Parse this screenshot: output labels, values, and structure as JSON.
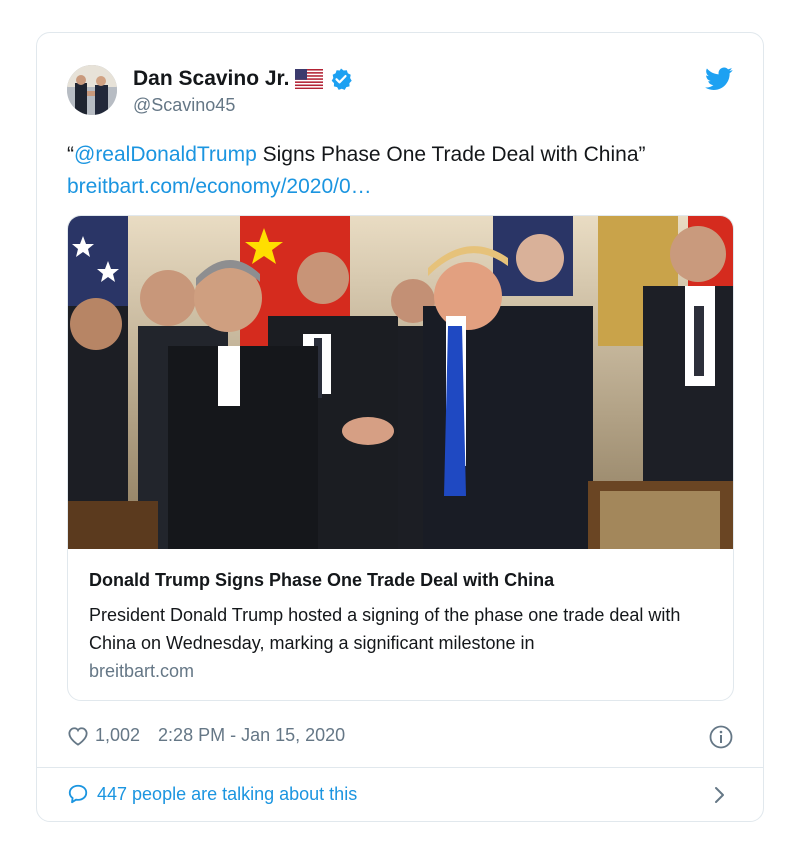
{
  "author": {
    "display_name": "Dan Scavino Jr.",
    "handle": "@Scavino45",
    "flag_icon": "us-flag-icon",
    "verified_icon": "verified-badge-icon"
  },
  "brand": {
    "icon": "twitter-bird-icon",
    "color": "#1da1f2"
  },
  "tweet": {
    "quote_open": "“",
    "mention": "@realDonaldTrump",
    "text_after_mention": " Signs Phase One Trade Deal with China”",
    "link_text": "breitbart.com/economy/2020/0…"
  },
  "card": {
    "image_icon": "photo-handshake",
    "title": "Donald Trump Signs Phase One Trade Deal with China",
    "description": "President Donald Trump hosted a signing of the phase one trade deal with China on Wednesday, marking a significant milestone in",
    "domain": "breitbart.com"
  },
  "meta": {
    "likes": "1,002",
    "timestamp": "2:28 PM - Jan 15, 2020",
    "info_icon": "info-icon"
  },
  "footer": {
    "talking_text": "447 people are talking about this",
    "link_color": "#1b95e0"
  }
}
